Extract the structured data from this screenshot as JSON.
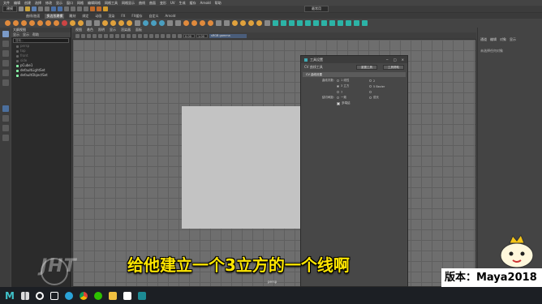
{
  "menubar": {
    "items": [
      "文件",
      "编辑",
      "创建",
      "选择",
      "修改",
      "显示",
      "窗口",
      "网格",
      "编辑网格",
      "网格工具",
      "网格显示",
      "曲线",
      "曲面",
      "变形",
      "UV",
      "生成",
      "缓存",
      "Arnold",
      "帮助"
    ]
  },
  "statusline": {
    "mode": "建模",
    "workspace": "最常用"
  },
  "shelf": {
    "tabs": [
      "曲线/曲面",
      "多边形建模",
      "雕刻",
      "绑定",
      "动画",
      "渲染",
      "FX",
      "FX缓存",
      "自定义",
      "Arnold"
    ],
    "active_tab": 1
  },
  "outliner": {
    "title": "大纲视图",
    "menu": [
      "显示",
      "显示",
      "帮助"
    ],
    "search_placeholder": "搜索...",
    "items": [
      {
        "label": "persp",
        "dim": true
      },
      {
        "label": "top",
        "dim": true
      },
      {
        "label": "front",
        "dim": true
      },
      {
        "label": "side",
        "dim": true
      },
      {
        "label": "pCube1",
        "dim": false
      },
      {
        "label": "defaultLightSet",
        "dim": false
      },
      {
        "label": "defaultObjectSet",
        "dim": false
      }
    ]
  },
  "viewport": {
    "menu": [
      "视图",
      "着色",
      "照明",
      "显示",
      "渲染器",
      "面板"
    ],
    "field1": "0.00",
    "field2": "1.00",
    "camera": "sRGB gamma",
    "label": "persp"
  },
  "dialog": {
    "title": "工具设置",
    "tool_name": "CV 曲线工具",
    "reset_button": "重置工具",
    "help_button": "工具帮助",
    "section": "CV 曲线设置",
    "rows": [
      {
        "label": "曲线次数:",
        "options": [
          {
            "text": "1 线性",
            "on": false
          },
          {
            "text": "2",
            "on": false
          }
        ]
      },
      {
        "label": "",
        "options": [
          {
            "text": "3 立方",
            "on": true
          },
          {
            "text": "5 Bezier",
            "on": false
          }
        ]
      },
      {
        "label": "",
        "options": [
          {
            "text": "7",
            "on": false
          },
          {
            "text": "",
            "on": false
          }
        ]
      },
      {
        "label": "结切间距:",
        "options": [
          {
            "text": "一致",
            "on": false
          },
          {
            "text": "弦长",
            "on": false
          }
        ]
      }
    ],
    "checkbox": "多端结"
  },
  "rightpanel": {
    "tabs": [
      "通道",
      "编辑",
      "对象",
      "显示"
    ],
    "line": "未选择任何对象"
  },
  "subtitle": "给他建立一个3立方的一个线啊",
  "version": "版本：Maya2018",
  "watermark": "JHT",
  "colors": {
    "accent_subtitle": "#ffe600",
    "viewport_bg": "#6e6e6e",
    "cube": "#c3c3c3"
  }
}
